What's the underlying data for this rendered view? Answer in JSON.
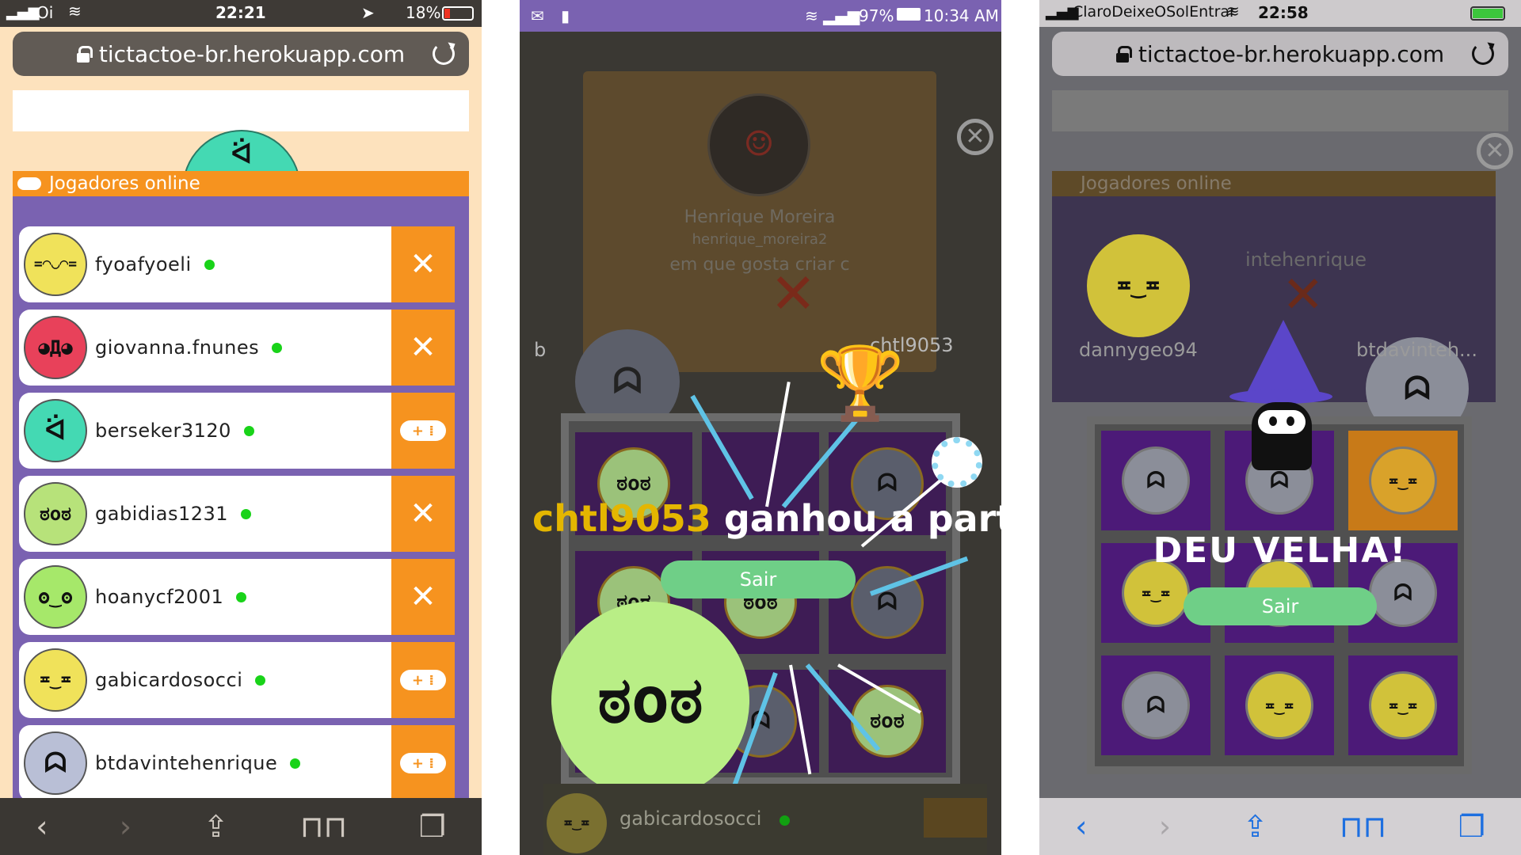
{
  "phone1": {
    "status": {
      "carrier": "Oi",
      "time": "22:21",
      "battery": "18%"
    },
    "url": "tictactoe-br.herokuapp.com",
    "section_title": "Jogadores online",
    "players": [
      {
        "name": "fyoafyoeli",
        "face": "=◠◡◠=",
        "color": "#f0e25a",
        "action": "challenge"
      },
      {
        "name": "giovanna.fnunes",
        "face": "◕Д◕",
        "color": "#e8415a",
        "action": "challenge"
      },
      {
        "name": "berseker3120",
        "face": "ᐛ",
        "color": "#44d9b3",
        "action": "play"
      },
      {
        "name": "gabidias1231",
        "face": "ಠoಠ",
        "color": "#b7e27a",
        "action": "challenge"
      },
      {
        "name": "hoanycf2001",
        "face": "ʘ‿ʘ",
        "color": "#a6e86a",
        "action": "challenge"
      },
      {
        "name": "gabicardosocci",
        "face": "≖‿≖",
        "color": "#f0e25a",
        "action": "play"
      },
      {
        "name": "btdavintehenrique",
        "face": "ᗣ",
        "color": "#b9bfd6",
        "action": "play"
      }
    ],
    "challenge_icon": "✕",
    "play_icon": "+ ⁞"
  },
  "phone2": {
    "status": {
      "wifi_signal": "97%",
      "time": "10:34 AM"
    },
    "profile": {
      "name": "Henrique Moreira",
      "handle": "henrique_moreira2",
      "message": "em que gosta criar c"
    },
    "opponent_label": "chtl9053",
    "winner_name": "chtl9053",
    "winner_suffix": " ganhou a partida",
    "exit_label": "Sair",
    "footer_player": "gabicardosocci",
    "close_icon": "✕",
    "colors": {
      "winner": "#e4b600",
      "accent": "#7a62b1"
    }
  },
  "phone3": {
    "status": {
      "carrier": "ClaroDeixeOSolEntrar",
      "time": "22:58"
    },
    "url": "tictactoe-br.herokuapp.com",
    "section_title": "Jogadores online",
    "left_player": "dannygeo94",
    "right_player": "btdavinteh...",
    "bg_player": "intehenrique",
    "draw_text": "DEU VELHA!",
    "exit_label": "Sair",
    "close_icon": "✕"
  }
}
